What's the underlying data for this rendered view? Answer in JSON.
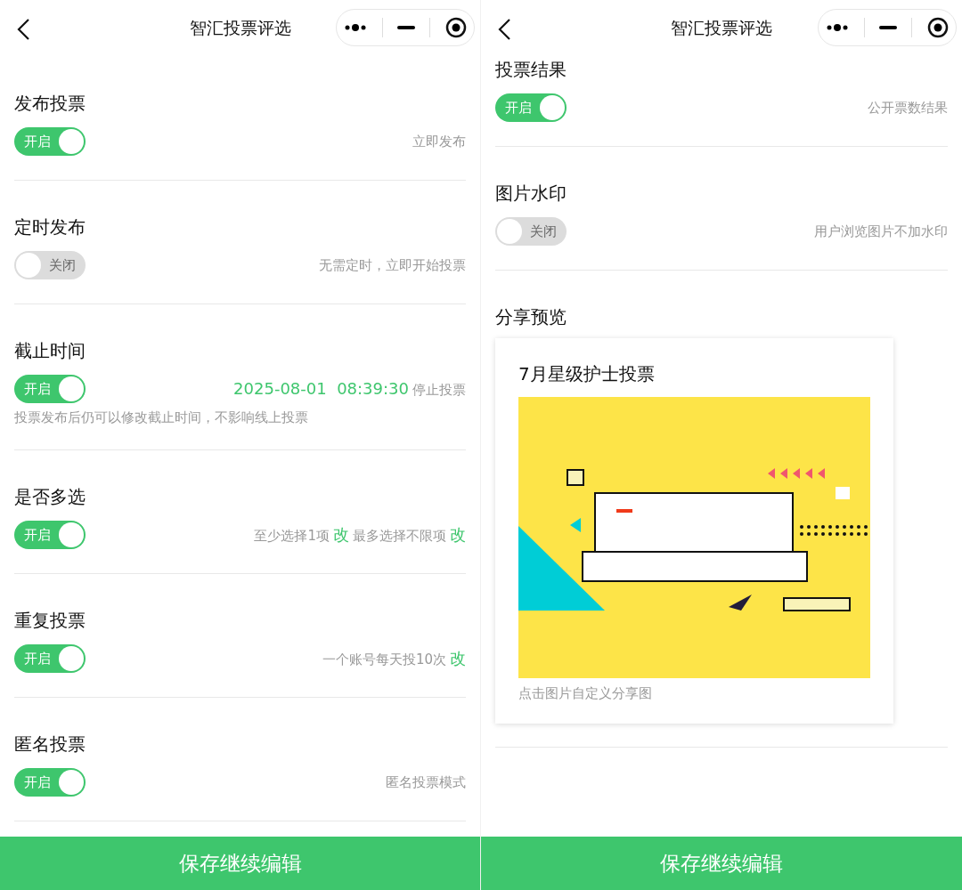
{
  "screens": [
    {
      "nav": {
        "title": "智汇投票评选"
      },
      "settings": [
        {
          "title": "发布投票",
          "toggle": {
            "on": true,
            "label": "开启"
          },
          "summary": [
            {
              "kind": "text",
              "text": "立即发布"
            }
          ]
        },
        {
          "title": "定时发布",
          "toggle": {
            "on": false,
            "label": "关闭"
          },
          "summary": [
            {
              "kind": "text",
              "text": "无需定时，立即开始投票"
            }
          ]
        },
        {
          "title": "截止时间",
          "toggle": {
            "on": true,
            "label": "开启"
          },
          "summary": [
            {
              "kind": "highlight",
              "text": "2025-08-01  08:39:30"
            },
            {
              "kind": "text",
              "text": "停止投票"
            }
          ],
          "note": "投票发布后仍可以修改截止时间，不影响线上投票"
        },
        {
          "title": "是否多选",
          "toggle": {
            "on": true,
            "label": "开启"
          },
          "summary": [
            {
              "kind": "text",
              "text": "至少选择1项"
            },
            {
              "kind": "link",
              "text": "改"
            },
            {
              "kind": "text",
              "text": "最多选择不限项"
            },
            {
              "kind": "link",
              "text": "改"
            }
          ]
        },
        {
          "title": "重复投票",
          "toggle": {
            "on": true,
            "label": "开启"
          },
          "summary": [
            {
              "kind": "text",
              "text": "一个账号每天投10次"
            },
            {
              "kind": "link",
              "text": "改"
            }
          ]
        },
        {
          "title": "匿名投票",
          "toggle": {
            "on": true,
            "label": "开启"
          },
          "summary": [
            {
              "kind": "text",
              "text": "匿名投票模式"
            }
          ]
        }
      ],
      "save_button": "保存继续编辑"
    },
    {
      "nav": {
        "title": "智汇投票评选"
      },
      "settings": [
        {
          "title": "投票结果",
          "toggle": {
            "on": true,
            "label": "开启"
          },
          "summary": [
            {
              "kind": "text",
              "text": "公开票数结果"
            }
          ]
        },
        {
          "title": "图片水印",
          "toggle": {
            "on": false,
            "label": "关闭"
          },
          "summary": [
            {
              "kind": "text",
              "text": "用户浏览图片不加水印"
            }
          ]
        }
      ],
      "share_preview": {
        "heading": "分享预览",
        "card_title": "7月星级护士投票",
        "caption": "点击图片自定义分享图"
      },
      "save_button": "保存继续编辑"
    }
  ]
}
